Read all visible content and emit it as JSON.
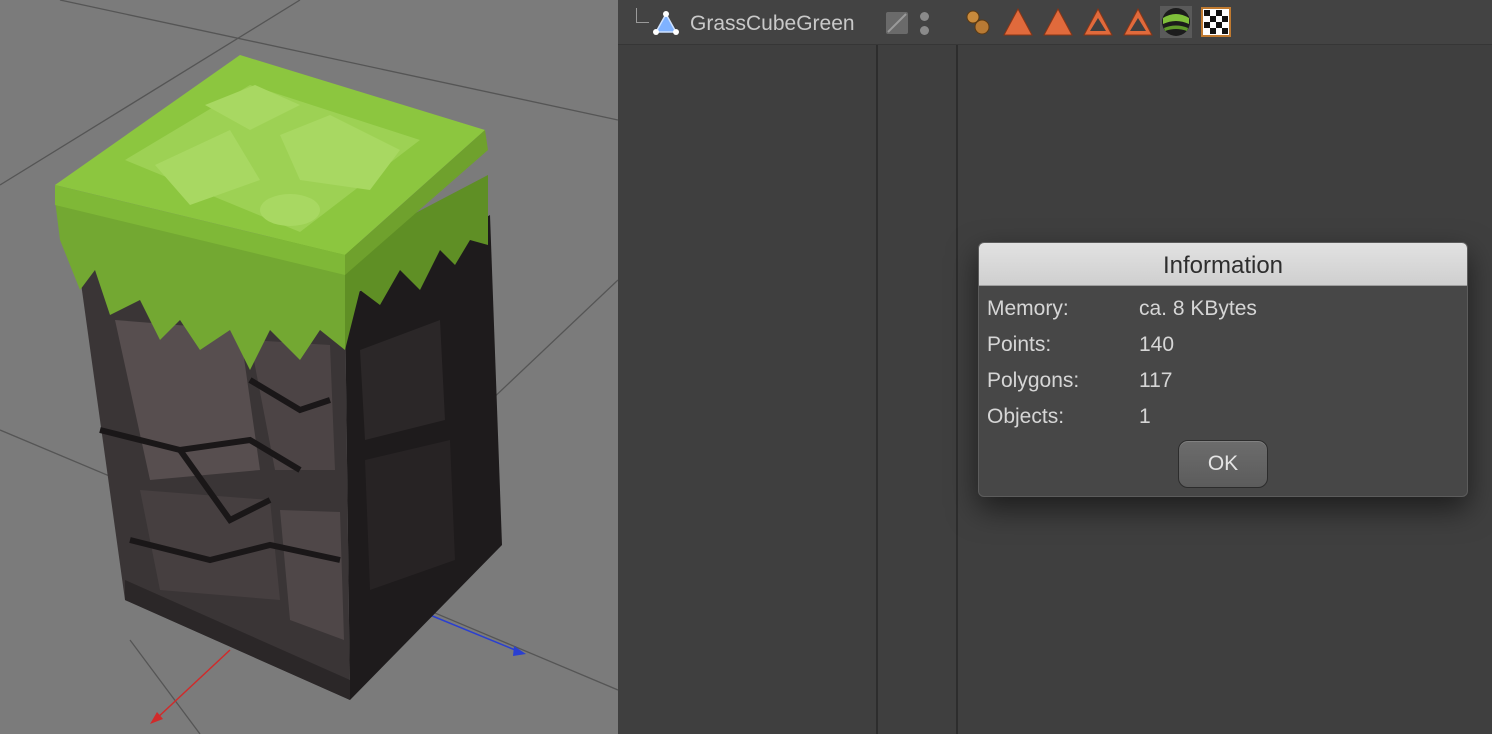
{
  "object_manager": {
    "object_name": "GrassCubeGreen",
    "object_icon": "polygon-object-icon",
    "tags": [
      {
        "icon": "texture-tag-mixed-icon"
      },
      {
        "icon": "material-tag-orange-icon"
      },
      {
        "icon": "material-tag-orange-icon"
      },
      {
        "icon": "selection-tag-outline-icon"
      },
      {
        "icon": "selection-tag-outline-icon"
      },
      {
        "icon": "material-tag-grass-sphere-icon"
      },
      {
        "icon": "uvw-tag-checker-icon"
      }
    ]
  },
  "dialog": {
    "title": "Information",
    "rows": [
      {
        "label": "Memory:",
        "value": "ca. 8 KBytes"
      },
      {
        "label": "Points:",
        "value": "140"
      },
      {
        "label": "Polygons:",
        "value": "117"
      },
      {
        "label": "Objects:",
        "value": "1"
      }
    ],
    "ok_label": "OK"
  },
  "colors": {
    "viewport_bg": "#7b7b7b",
    "panel_bg": "#3f3f3f",
    "grass": "#8cc63f",
    "rock": "#3a3536",
    "axis_x": "#d12a2a",
    "axis_z": "#2a3fd1",
    "tag_orange": "#e06a3c"
  }
}
